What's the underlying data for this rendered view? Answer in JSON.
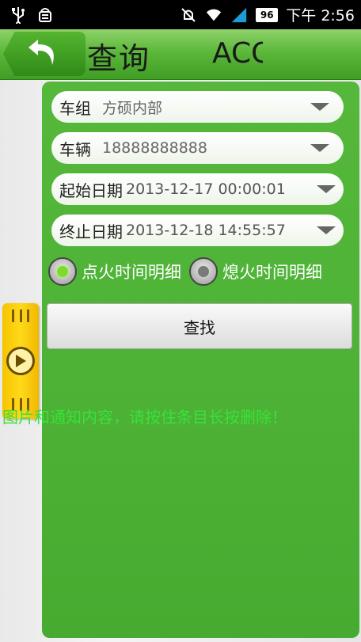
{
  "status_bar": {
    "icons_left": [
      "usb-icon",
      "android-debug-icon"
    ],
    "icons_right": [
      "mute-icon",
      "wifi-icon",
      "signal-icon",
      "battery-icon"
    ],
    "battery": "96",
    "time": "下午 2:56"
  },
  "titlebar": {
    "back_icon": "back-arrow-icon",
    "title": "查询",
    "subtitle": "ACC"
  },
  "form": {
    "group": {
      "label": "车组",
      "value": "方硕内部"
    },
    "vehicle": {
      "label": "车辆",
      "value": "18888888888"
    },
    "start_date": {
      "label": "起始日期",
      "value": "2013-12-17 00:00:01"
    },
    "end_date": {
      "label": "终止日期",
      "value": "2013-12-18 14:55:57"
    }
  },
  "radio": {
    "ignition_on": {
      "label": "点火时间明细",
      "checked": true
    },
    "ignition_off": {
      "label": "熄火时间明细",
      "checked": false
    }
  },
  "search_button": "查找",
  "hint": "图片和通知内容，请按住条目长按删除！",
  "colors": {
    "accent_green": "#4cb135",
    "radio_checked": "#7cdc2c",
    "handle_yellow": "#ffd91a",
    "hint_text": "#39e23a"
  }
}
